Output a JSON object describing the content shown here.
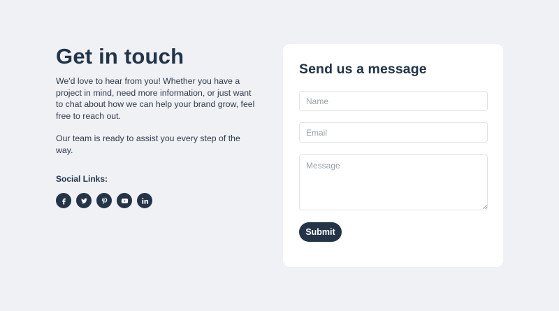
{
  "contact": {
    "title": "Get in touch",
    "intro": "We'd love to hear from you! Whether you have a project in mind, need more information, or just want to chat about how we can help your brand grow, feel free to reach out.",
    "intro2": "Our team is ready to assist you every step of the way.",
    "social_title": "Social Links:",
    "socials": [
      {
        "icon": "facebook-icon"
      },
      {
        "icon": "twitter-icon"
      },
      {
        "icon": "pinterest-icon"
      },
      {
        "icon": "youtube-icon"
      },
      {
        "icon": "linkedin-icon"
      }
    ]
  },
  "form": {
    "title": "Send us a message",
    "name_placeholder": "Name",
    "email_placeholder": "Email",
    "message_placeholder": "Message",
    "name_value": "",
    "email_value": "",
    "message_value": "",
    "submit_label": "Submit"
  },
  "colors": {
    "background": "#f0f1f5",
    "card": "#ffffff",
    "primary": "#243448",
    "text": "#2f3a4a"
  }
}
